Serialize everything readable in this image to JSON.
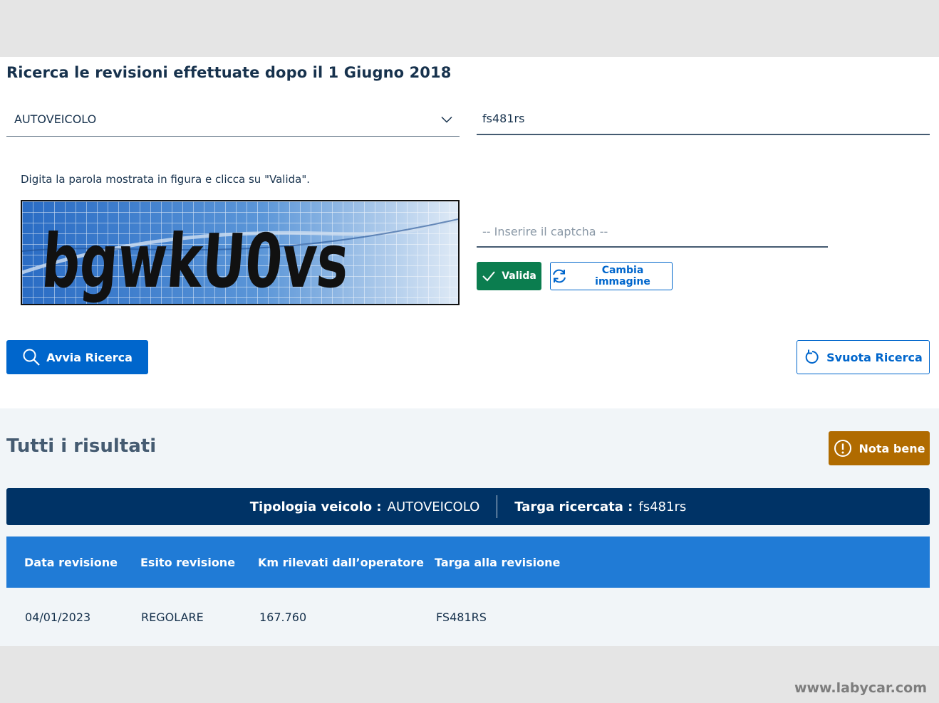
{
  "header": {
    "title": "Ricerca le revisioni effettuate dopo il 1 Giugno 2018"
  },
  "form": {
    "vehicle_type": "AUTOVEICOLO",
    "plate_value": "fs481rs",
    "captcha_hint": "Digita la parola mostrata in figura e clicca su \"Valida\".",
    "captcha_text": "bgwkU0vs",
    "captcha_placeholder": "-- Inserire il captcha --",
    "valida_label": "Valida",
    "cambia_label": "Cambia immagine",
    "avvia_label": "Avvia Ricerca",
    "svuota_label": "Svuota Ricerca"
  },
  "results": {
    "title": "Tutti i risultati",
    "nota_label": "Nota bene",
    "summary": {
      "tipologia_label": "Tipologia veicolo :",
      "tipologia_value": "AUTOVEICOLO",
      "targa_label": "Targa ricercata :",
      "targa_value": "fs481rs"
    },
    "columns": [
      "Data revisione",
      "Esito revisione",
      "Km rilevati dall’operatore",
      "Targa alla revisione"
    ],
    "rows": [
      [
        "04/01/2023",
        "REGOLARE",
        "167.760",
        "FS481RS"
      ]
    ]
  },
  "watermark": "www.labycar.com",
  "colors": {
    "primary": "#0066cc",
    "navy": "#003366",
    "table_header": "#207bd6",
    "success": "#0b7d4f",
    "warning": "#b06b00"
  },
  "icons": [
    "chevron-down-icon",
    "check-icon",
    "refresh-icon",
    "search-icon",
    "reset-icon",
    "exclamation-circle-icon"
  ]
}
